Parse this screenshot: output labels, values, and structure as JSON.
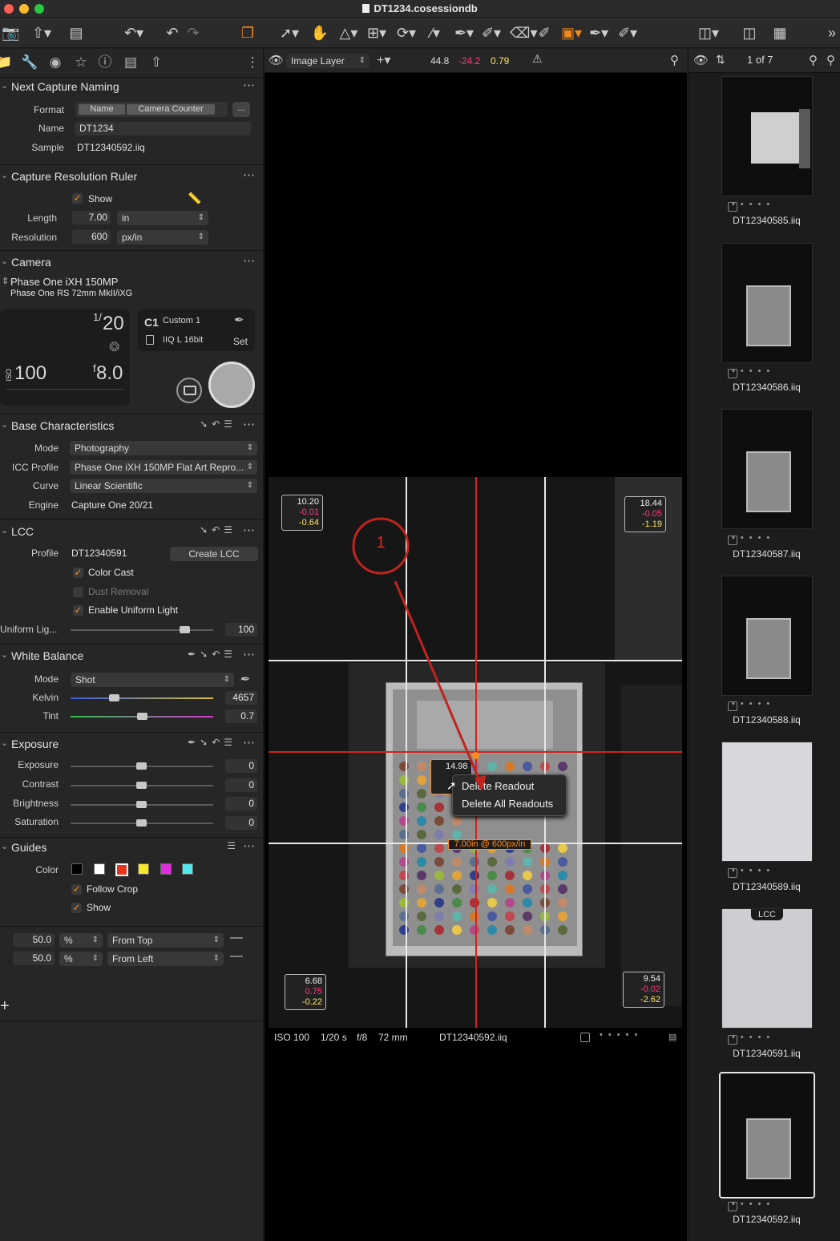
{
  "window": {
    "title": "DT1234.cosessiondb"
  },
  "left_panel": {
    "capture_naming": {
      "title": "Next Capture Naming",
      "format_label": "Format",
      "format_tokens": [
        "Name",
        "Camera Counter"
      ],
      "format_more": "...",
      "name_label": "Name",
      "name_value": "DT1234",
      "sample_label": "Sample",
      "sample_value": "DT12340592.iiq"
    },
    "ruler": {
      "title": "Capture Resolution Ruler",
      "show_label": "Show",
      "length_label": "Length",
      "length_value": "7.00",
      "length_unit": "in",
      "resolution_label": "Resolution",
      "resolution_value": "600",
      "resolution_unit": "px/in"
    },
    "camera": {
      "title": "Camera",
      "model": "Phase One iXH 150MP",
      "lens": "Phase One RS 72mm MkII/iXG",
      "shutter_num": "1/",
      "shutter_den": "20",
      "iso_prefix": "ISO",
      "iso": "100",
      "aperture_prefix": "f",
      "aperture": "8.0",
      "preset_badge": "C1",
      "preset_name": "Custom 1",
      "file_format": "IIQ L 16bit",
      "set_label": "Set"
    },
    "base": {
      "title": "Base Characteristics",
      "mode_label": "Mode",
      "mode_value": "Photography",
      "icc_label": "ICC Profile",
      "icc_value": "Phase One iXH 150MP Flat Art Repro...",
      "curve_label": "Curve",
      "curve_value": "Linear Scientific",
      "engine_label": "Engine",
      "engine_value": "Capture One 20/21"
    },
    "lcc": {
      "title": "LCC",
      "profile_label": "Profile",
      "profile_value": "DT12340591",
      "create_button": "Create LCC",
      "color_cast": "Color Cast",
      "dust_removal": "Dust Removal",
      "uniform_light": "Enable Uniform Light",
      "uniform_label": "Uniform Lig...",
      "uniform_value": "100"
    },
    "white_balance": {
      "title": "White Balance",
      "mode_label": "Mode",
      "mode_value": "Shot",
      "kelvin_label": "Kelvin",
      "kelvin_value": "4657",
      "tint_label": "Tint",
      "tint_value": "0.7"
    },
    "exposure": {
      "title": "Exposure",
      "rows": [
        {
          "label": "Exposure",
          "value": "0"
        },
        {
          "label": "Contrast",
          "value": "0"
        },
        {
          "label": "Brightness",
          "value": "0"
        },
        {
          "label": "Saturation",
          "value": "0"
        }
      ]
    },
    "guides": {
      "title": "Guides",
      "color_label": "Color",
      "swatches": [
        "#000000",
        "#ffffff",
        "#e8341c",
        "#f5e72a",
        "#e22ce0",
        "#52e8ec"
      ],
      "follow_crop": "Follow Crop",
      "show": "Show",
      "row1_value": "50.0",
      "row1_unit": "%",
      "row1_ref": "From Top",
      "row2_value": "50.0",
      "row2_unit": "%",
      "row2_ref": "From Left"
    }
  },
  "viewer": {
    "layer": "Image Layer",
    "readout_l": "44.8",
    "readout_a": "-24.2",
    "readout_b": "0.79",
    "corner_readouts": {
      "tl": [
        "10.20",
        "-0.01",
        "-0.64"
      ],
      "tr": [
        "18.44",
        "-0.05",
        "-1.19"
      ],
      "bl": [
        "6.68",
        "0.75",
        "-0.22"
      ],
      "br": [
        "9.54",
        "-0.02",
        "-2.62"
      ]
    },
    "center_readout": "14.98",
    "ruler_label": "7.00in @ 600px/in",
    "annotation_number": "1",
    "context_menu": [
      "Delete Readout",
      "Delete All Readouts"
    ],
    "info": {
      "iso": "ISO 100",
      "shutter": "1/20 s",
      "aperture": "f/8",
      "focal": "72 mm",
      "file": "DT12340592.iiq"
    }
  },
  "browser": {
    "counter": "1 of 7",
    "lcc_badge": "LCC",
    "thumbs": [
      "DT12340585.iiq",
      "DT12340586.iiq",
      "DT12340587.iiq",
      "DT12340588.iiq",
      "DT12340589.iiq",
      "DT12340591.iiq",
      "DT12340592.iiq"
    ]
  },
  "colors": {
    "accent": "#ff8c1a",
    "guide_red": "#d0251f",
    "readout_a": "#ff3d7f",
    "readout_b": "#ffe45a"
  }
}
